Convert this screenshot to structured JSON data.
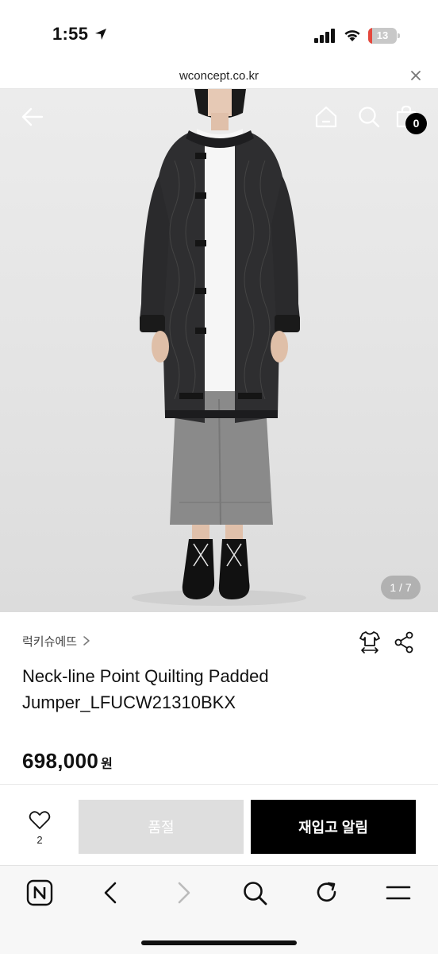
{
  "status_bar": {
    "time": "1:55",
    "battery_level": "13",
    "battery_fraction": 0.13
  },
  "browser": {
    "url": "wconcept.co.kr"
  },
  "header": {
    "cart_count": "0"
  },
  "gallery": {
    "counter": "1 / 7"
  },
  "product": {
    "brand": "럭키슈에뜨",
    "title": "Neck-line Point Quilting Padded Jumper_LFUCW21310BKX",
    "price": "698,000",
    "currency": "원"
  },
  "purchase": {
    "like_count": "2",
    "soldout_label": "품절",
    "restock_label": "재입고 알림"
  },
  "icons": {
    "status": [
      "location-arrow-icon",
      "signal-icon",
      "wifi-icon",
      "battery-icon"
    ],
    "header": [
      "back-arrow-icon",
      "home-icon",
      "search-icon",
      "shopping-bag-icon"
    ],
    "product": [
      "chevron-right-icon",
      "size-guide-icon",
      "share-icon",
      "heart-icon"
    ],
    "toolbar": [
      "naver-icon",
      "back-icon",
      "forward-icon",
      "search-icon",
      "reload-icon",
      "menu-icon"
    ]
  },
  "colors": {
    "accent": "#000000",
    "battery_low": "#e5483d",
    "soldout_bg": "#dedede"
  }
}
